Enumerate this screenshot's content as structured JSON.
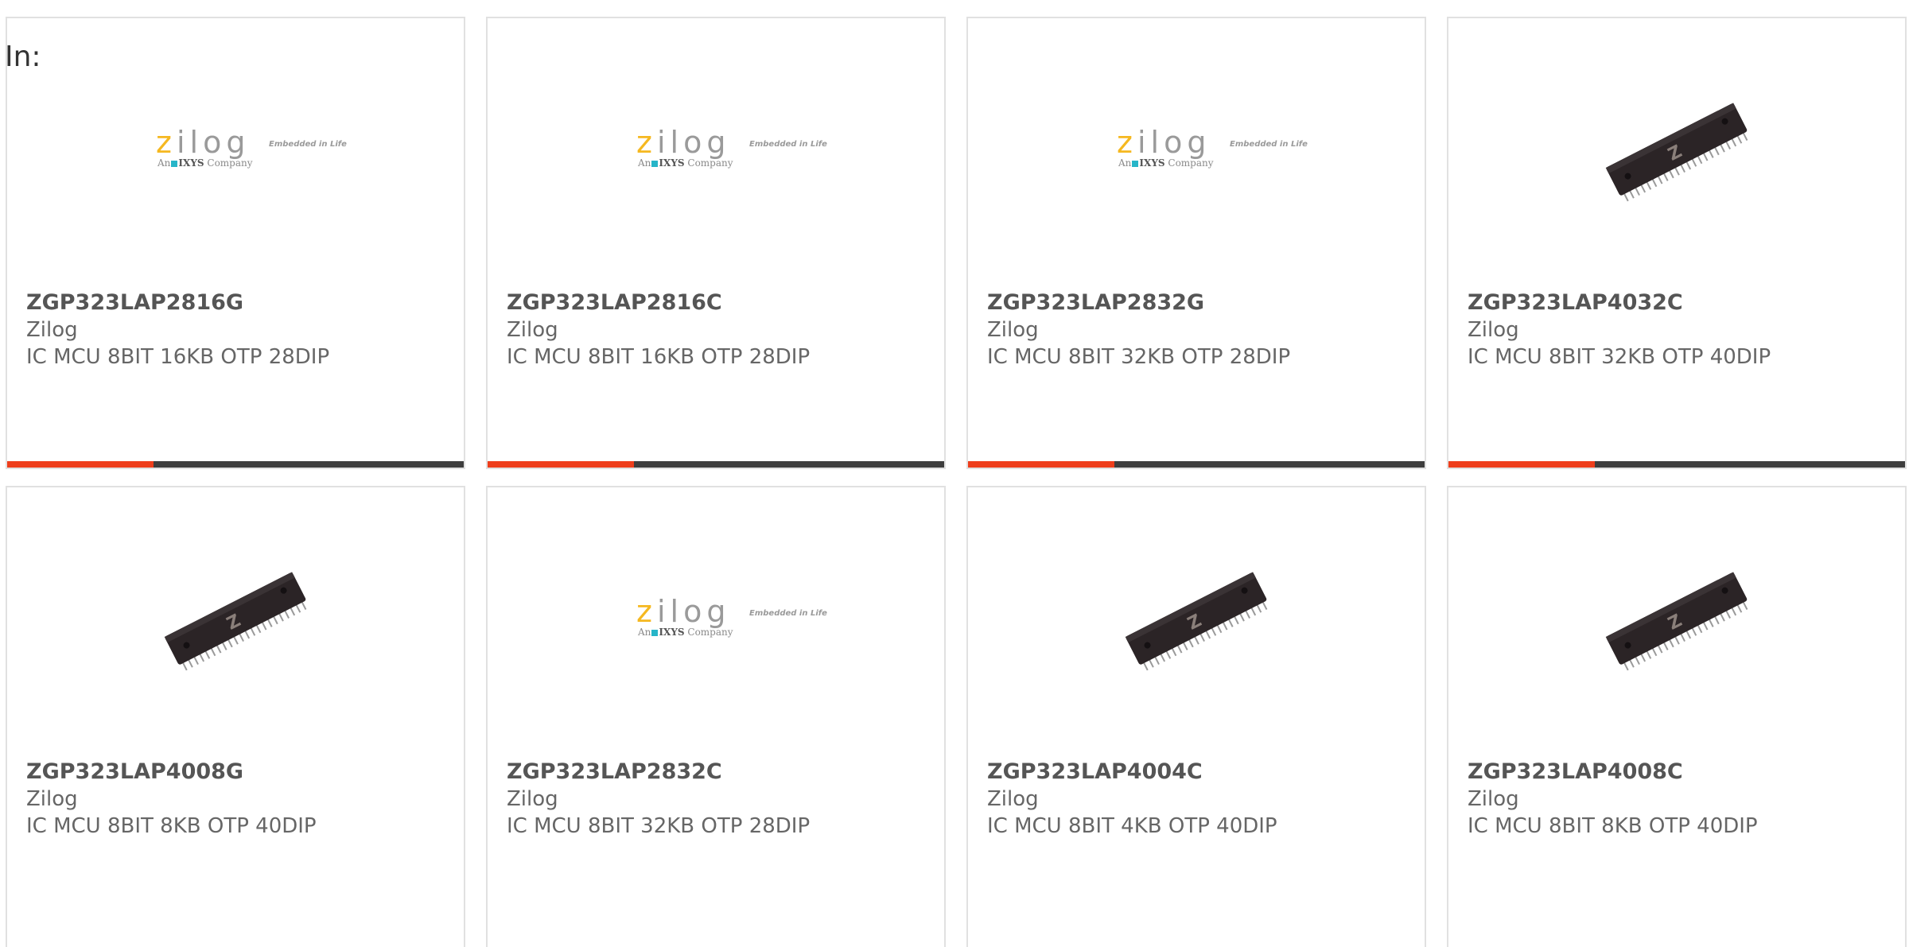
{
  "filter": {
    "label": "In:"
  },
  "colors": {
    "accent": "#ee3e1c",
    "bar": "#3e3e3e",
    "card_border": "#e1e1e1",
    "text": "#666666"
  },
  "logo": {
    "brand_z": "z",
    "brand_rest": "ilog",
    "tagline": "Embedded in Life",
    "sub_prefix": "An",
    "sub_brand": "IXYS",
    "sub_suffix": "Company"
  },
  "products": [
    {
      "part": "ZGP323LAP2816G",
      "maker": "Zilog",
      "desc": "IC MCU 8BIT 16KB OTP 28DIP",
      "image": "zilog-logo"
    },
    {
      "part": "ZGP323LAP2816C",
      "maker": "Zilog",
      "desc": "IC MCU 8BIT 16KB OTP 28DIP",
      "image": "zilog-logo"
    },
    {
      "part": "ZGP323LAP2832G",
      "maker": "Zilog",
      "desc": "IC MCU 8BIT 32KB OTP 28DIP",
      "image": "zilog-logo"
    },
    {
      "part": "ZGP323LAP4032C",
      "maker": "Zilog",
      "desc": "IC MCU 8BIT 32KB OTP 40DIP",
      "image": "dip-chip"
    },
    {
      "part": "ZGP323LAP4008G",
      "maker": "Zilog",
      "desc": "IC MCU 8BIT 8KB OTP 40DIP",
      "image": "dip-chip"
    },
    {
      "part": "ZGP323LAP2832C",
      "maker": "Zilog",
      "desc": "IC MCU 8BIT 32KB OTP 28DIP",
      "image": "zilog-logo"
    },
    {
      "part": "ZGP323LAP4004C",
      "maker": "Zilog",
      "desc": "IC MCU 8BIT 4KB OTP 40DIP",
      "image": "dip-chip"
    },
    {
      "part": "ZGP323LAP4008C",
      "maker": "Zilog",
      "desc": "IC MCU 8BIT 8KB OTP 40DIP",
      "image": "dip-chip"
    }
  ]
}
